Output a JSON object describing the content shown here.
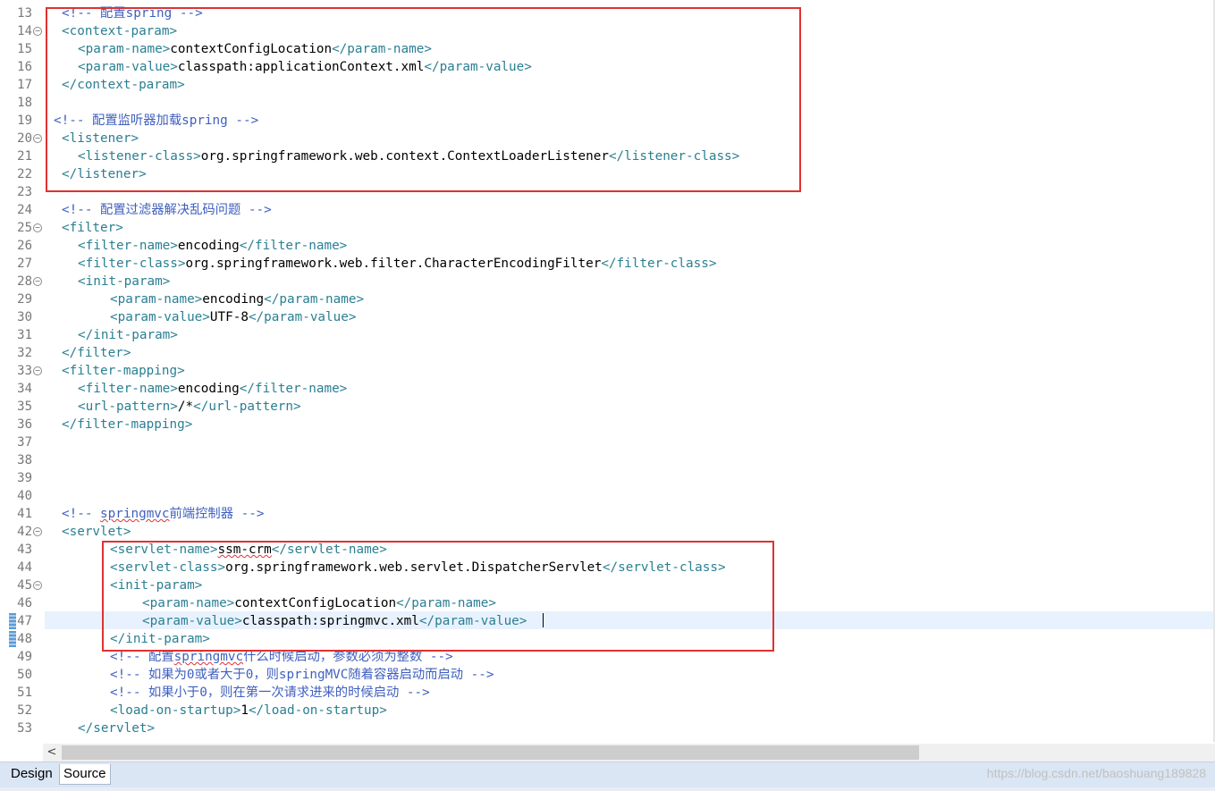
{
  "editor": {
    "lines": [
      {
        "n": "13",
        "fold": false,
        "indent": 1,
        "parts": [
          [
            "c",
            "<!-- 配置spring -->"
          ]
        ]
      },
      {
        "n": "14",
        "fold": true,
        "indent": 1,
        "parts": [
          [
            "t",
            "<context-param>"
          ]
        ]
      },
      {
        "n": "15",
        "fold": false,
        "indent": 2,
        "parts": [
          [
            "t",
            "<param-name>"
          ],
          [
            "x",
            "contextConfigLocation"
          ],
          [
            "t",
            "</param-name>"
          ]
        ]
      },
      {
        "n": "16",
        "fold": false,
        "indent": 2,
        "parts": [
          [
            "t",
            "<param-value>"
          ],
          [
            "x",
            "classpath:applicationContext.xml"
          ],
          [
            "t",
            "</param-value>"
          ]
        ]
      },
      {
        "n": "17",
        "fold": false,
        "indent": 1,
        "parts": [
          [
            "t",
            "</context-param>"
          ]
        ]
      },
      {
        "n": "18",
        "fold": false,
        "indent": 0,
        "parts": []
      },
      {
        "n": "19",
        "fold": false,
        "indent": 0,
        "parts": [
          [
            "c",
            "<!-- 配置监听器加载spring -->"
          ]
        ]
      },
      {
        "n": "20",
        "fold": true,
        "indent": 1,
        "parts": [
          [
            "t",
            "<listener>"
          ]
        ]
      },
      {
        "n": "21",
        "fold": false,
        "indent": 2,
        "parts": [
          [
            "t",
            "<listener-class>"
          ],
          [
            "x",
            "org.springframework.web.context.ContextLoaderListener"
          ],
          [
            "t",
            "</listener-class>"
          ]
        ]
      },
      {
        "n": "22",
        "fold": false,
        "indent": 1,
        "parts": [
          [
            "t",
            "</listener>"
          ]
        ]
      },
      {
        "n": "23",
        "fold": false,
        "indent": 0,
        "parts": []
      },
      {
        "n": "24",
        "fold": false,
        "indent": 1,
        "parts": [
          [
            "c",
            "<!-- 配置过滤器解决乱码问题 -->"
          ]
        ]
      },
      {
        "n": "25",
        "fold": true,
        "indent": 1,
        "parts": [
          [
            "t",
            "<filter>"
          ]
        ]
      },
      {
        "n": "26",
        "fold": false,
        "indent": 2,
        "parts": [
          [
            "t",
            "<filter-name>"
          ],
          [
            "x",
            "encoding"
          ],
          [
            "t",
            "</filter-name>"
          ]
        ]
      },
      {
        "n": "27",
        "fold": false,
        "indent": 2,
        "parts": [
          [
            "t",
            "<filter-class>"
          ],
          [
            "x",
            "org.springframework.web.filter.CharacterEncodingFilter"
          ],
          [
            "t",
            "</filter-class>"
          ]
        ]
      },
      {
        "n": "28",
        "fold": true,
        "indent": 2,
        "parts": [
          [
            "t",
            "<init-param>"
          ]
        ]
      },
      {
        "n": "29",
        "fold": false,
        "indent": 3,
        "parts": [
          [
            "t",
            "<param-name>"
          ],
          [
            "x",
            "encoding"
          ],
          [
            "t",
            "</param-name>"
          ]
        ]
      },
      {
        "n": "30",
        "fold": false,
        "indent": 3,
        "parts": [
          [
            "t",
            "<param-value>"
          ],
          [
            "x",
            "UTF-8"
          ],
          [
            "t",
            "</param-value>"
          ]
        ]
      },
      {
        "n": "31",
        "fold": false,
        "indent": 2,
        "parts": [
          [
            "t",
            "</init-param>"
          ]
        ]
      },
      {
        "n": "32",
        "fold": false,
        "indent": 1,
        "parts": [
          [
            "t",
            "</filter>"
          ]
        ]
      },
      {
        "n": "33",
        "fold": true,
        "indent": 1,
        "parts": [
          [
            "t",
            "<filter-mapping>"
          ]
        ]
      },
      {
        "n": "34",
        "fold": false,
        "indent": 2,
        "parts": [
          [
            "t",
            "<filter-name>"
          ],
          [
            "x",
            "encoding"
          ],
          [
            "t",
            "</filter-name>"
          ]
        ]
      },
      {
        "n": "35",
        "fold": false,
        "indent": 2,
        "parts": [
          [
            "t",
            "<url-pattern>"
          ],
          [
            "x",
            "/*"
          ],
          [
            "t",
            "</url-pattern>"
          ]
        ]
      },
      {
        "n": "36",
        "fold": false,
        "indent": 1,
        "parts": [
          [
            "t",
            "</filter-mapping>"
          ]
        ]
      },
      {
        "n": "37",
        "fold": false,
        "indent": 0,
        "parts": []
      },
      {
        "n": "38",
        "fold": false,
        "indent": 0,
        "parts": []
      },
      {
        "n": "39",
        "fold": false,
        "indent": 0,
        "parts": []
      },
      {
        "n": "40",
        "fold": false,
        "indent": 0,
        "parts": []
      },
      {
        "n": "41",
        "fold": false,
        "indent": 1,
        "parts": [
          [
            "c",
            "<!-- "
          ],
          [
            "cs",
            "springmvc"
          ],
          [
            "c",
            "前端控制器 -->"
          ]
        ]
      },
      {
        "n": "42",
        "fold": true,
        "indent": 1,
        "parts": [
          [
            "t",
            "<servlet>"
          ]
        ]
      },
      {
        "n": "43",
        "fold": false,
        "indent": 3,
        "parts": [
          [
            "t",
            "<servlet-name>"
          ],
          [
            "xs",
            "ssm-crm"
          ],
          [
            "t",
            "</servlet-name>"
          ]
        ]
      },
      {
        "n": "44",
        "fold": false,
        "indent": 3,
        "parts": [
          [
            "t",
            "<servlet-class>"
          ],
          [
            "x",
            "org.springframework.web.servlet.DispatcherServlet"
          ],
          [
            "t",
            "</servlet-class>"
          ]
        ]
      },
      {
        "n": "45",
        "fold": true,
        "indent": 3,
        "parts": [
          [
            "t",
            "<init-param>"
          ]
        ]
      },
      {
        "n": "46",
        "fold": false,
        "indent": 4,
        "parts": [
          [
            "t",
            "<param-name>"
          ],
          [
            "x",
            "contextConfigLocation"
          ],
          [
            "t",
            "</param-name>"
          ]
        ]
      },
      {
        "n": "47",
        "fold": false,
        "indent": 4,
        "parts": [
          [
            "t",
            "<param-value>"
          ],
          [
            "x",
            "classpath:springmvc.xml"
          ],
          [
            "t",
            "</param-value>"
          ]
        ]
      },
      {
        "n": "48",
        "fold": false,
        "indent": 3,
        "parts": [
          [
            "t",
            "</init-param>"
          ]
        ]
      },
      {
        "n": "49",
        "fold": false,
        "indent": 3,
        "parts": [
          [
            "c",
            "<!-- 配置"
          ],
          [
            "cs",
            "springmvc"
          ],
          [
            "c",
            "什么时候启动，参数必须为整数 -->"
          ]
        ]
      },
      {
        "n": "50",
        "fold": false,
        "indent": 3,
        "parts": [
          [
            "c",
            "<!-- 如果为0或者大于0，则springMVC随着容器启动而启动 -->"
          ]
        ]
      },
      {
        "n": "51",
        "fold": false,
        "indent": 3,
        "parts": [
          [
            "c",
            "<!-- 如果小于0，则在第一次请求进来的时候启动 -->"
          ]
        ]
      },
      {
        "n": "52",
        "fold": false,
        "indent": 3,
        "parts": [
          [
            "t",
            "<load-on-startup>"
          ],
          [
            "x",
            "1"
          ],
          [
            "t",
            "</load-on-startup>"
          ]
        ]
      },
      {
        "n": "53",
        "fold": false,
        "indent": 2,
        "parts": [
          [
            "t",
            "</servlet>"
          ]
        ]
      }
    ]
  },
  "tabs": {
    "design": "Design",
    "source": "Source"
  },
  "scrollbar": {
    "left_arrow": "<"
  },
  "watermark": "https://blog.csdn.net/baoshuang189828"
}
